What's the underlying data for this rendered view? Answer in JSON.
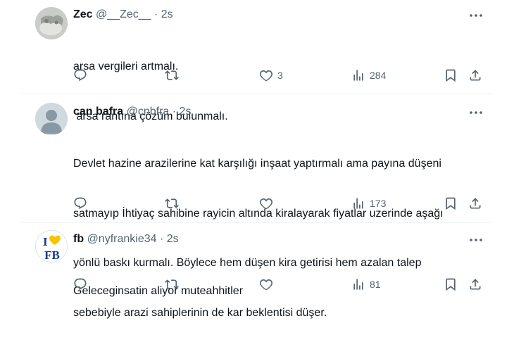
{
  "tweets": [
    {
      "name": "Zec",
      "handle": "@__Zec__",
      "sep": "·",
      "time": "2s",
      "text_lines": [
        "arsa vergileri artmalı.",
        " arsa rantına çözüm bulunmalı."
      ],
      "likes": "3",
      "views": "284"
    },
    {
      "name": "can bafra",
      "handle": "@cnbfra",
      "sep": "·",
      "time": "2s",
      "text_lines": [
        "Devlet hazine arazilerine kat karşılığı inşaat yaptırmalı ama payına düşeni",
        "satmayıp İhtiyaç sahibine rayicin altında kiralayarak fiyatlar uzerinde aşağı",
        "yönlü baskı kurmalı. Böylece hem düşen kira getirisi hem azalan talep",
        "sebebiyle arazi sahiplerinin de kar beklentisi düşer."
      ],
      "likes": "",
      "views": "173"
    },
    {
      "name": "fb",
      "handle": "@nyfrankie34",
      "sep": "·",
      "time": "2s",
      "text_lines": [
        "Geleceginsatin aliyor muteahhitler"
      ],
      "likes": "",
      "views": "81",
      "avatar_logo": {
        "top": "I",
        "bottom": "FB"
      }
    }
  ],
  "icons": {
    "reply": "reply-icon",
    "retweet": "retweet-icon",
    "like": "like-icon",
    "views": "views-icon",
    "bookmark": "bookmark-icon",
    "share": "share-icon",
    "more": "more-icon"
  },
  "colors": {
    "text": "#0f1419",
    "secondary": "#536471",
    "divider": "#eff3f4",
    "fb_logo": "#1a3c8c",
    "heart_yellow": "#f5c400"
  }
}
